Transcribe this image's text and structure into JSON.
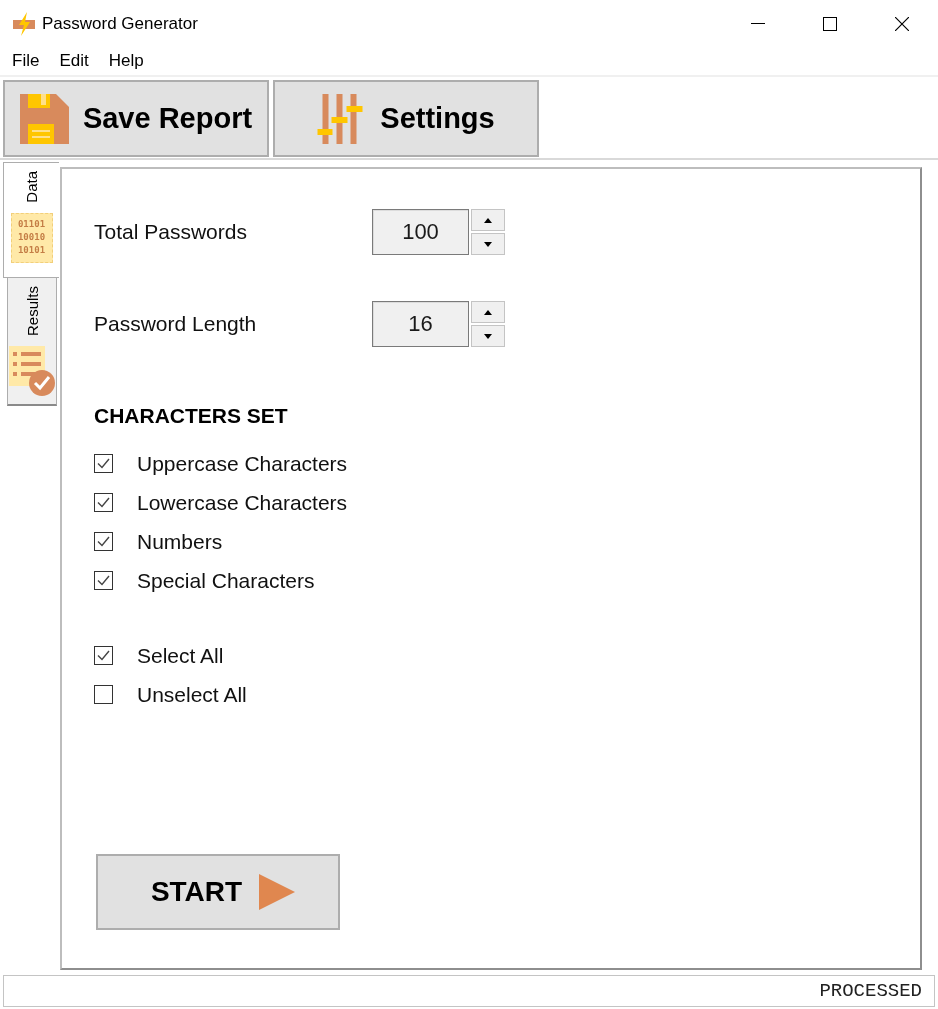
{
  "window": {
    "title": "Password Generator"
  },
  "menu": [
    {
      "label": "File"
    },
    {
      "label": "Edit"
    },
    {
      "label": "Help"
    }
  ],
  "toolbar": [
    {
      "label": "Save Report",
      "kind": "save"
    },
    {
      "label": "Settings",
      "kind": "settings"
    }
  ],
  "side_tabs": [
    {
      "label": "Data",
      "kind": "data",
      "selected": true,
      "icon_lines": [
        "01101",
        "10010",
        "10101"
      ]
    },
    {
      "label": "Results",
      "kind": "results",
      "selected": false
    }
  ],
  "fields": [
    {
      "label": "Total Passwords",
      "value": "100"
    },
    {
      "label": "Password Length",
      "value": "16"
    }
  ],
  "character_set": {
    "heading": "CHARACTERS SET",
    "options": [
      {
        "label": "Uppercase Characters",
        "checked": true
      },
      {
        "label": "Lowercase Characters",
        "checked": true
      },
      {
        "label": "Numbers",
        "checked": true
      },
      {
        "label": "Special Characters",
        "checked": true
      }
    ]
  },
  "selection": [
    {
      "label": "Select All",
      "checked": true
    },
    {
      "label": "Unselect All",
      "checked": false
    }
  ],
  "start_button": {
    "label": "START"
  },
  "status_bar": {
    "text": "PROCESSED"
  }
}
